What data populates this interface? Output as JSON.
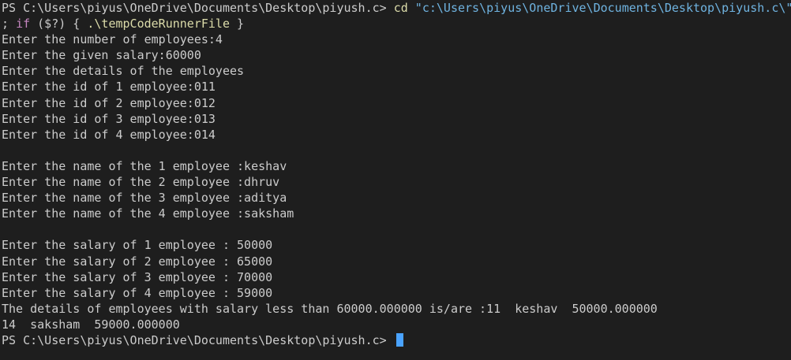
{
  "terminal": {
    "prompt1": "PS C:\\Users\\piyus\\OneDrive\\Documents\\Desktop\\piyush.c> ",
    "cmd_cd": "cd",
    "cmd_path": "\"c:\\Users\\piyus\\OneDrive\\Documents\\Desktop\\piyush.c\\\"",
    "cmd_line2_a": "; ",
    "cmd_if": "if",
    "cmd_line2_b": " ($?) { ",
    "cmd_exec": ".\\tempCodeRunnerFile",
    "cmd_line2_c": " }",
    "output": [
      "Enter the number of employees:4",
      "Enter the given salary:60000",
      "Enter the details of the employees",
      "Enter the id of 1 employee:011",
      "Enter the id of 2 employee:012",
      "Enter the id of 3 employee:013",
      "Enter the id of 4 employee:014",
      "",
      "Enter the name of the 1 employee :keshav",
      "Enter the name of the 2 employee :dhruv",
      "Enter the name of the 3 employee :aditya",
      "Enter the name of the 4 employee :saksham",
      "",
      "Enter the salary of 1 employee : 50000",
      "Enter the salary of 2 employee : 65000",
      "Enter the salary of 3 employee : 70000",
      "Enter the salary of 4 employee : 59000",
      "The details of employees with salary less than 60000.000000 is/are :11  keshav  50000.000000",
      "14  saksham  59000.000000"
    ],
    "prompt2": "PS C:\\Users\\piyus\\OneDrive\\Documents\\Desktop\\piyush.c> ",
    "colors": {
      "background": "#1e1e1e",
      "text": "#cccccc",
      "command": "#dcdcaa",
      "string": "#6fb3e0",
      "keyword": "#c586c0",
      "cursor": "#4aa3ff"
    }
  }
}
